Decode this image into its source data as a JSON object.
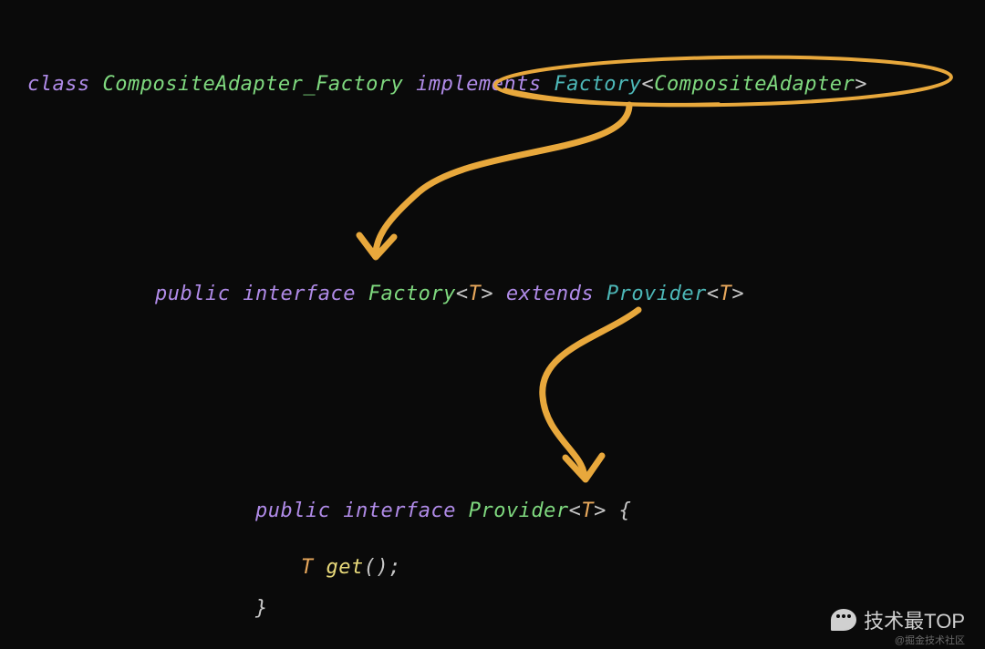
{
  "line1": {
    "class_kw": "class",
    "class_name": "CompositeAdapter_Factory",
    "implements_kw": "implements",
    "factory": "Factory",
    "lt": "<",
    "generic": "CompositeAdapter",
    "gt": ">"
  },
  "line2": {
    "public_kw": "public",
    "interface_kw": "interface",
    "factory": "Factory",
    "lt": "<",
    "t": "T",
    "gt": ">",
    "extends_kw": "extends",
    "provider": "Provider",
    "lt2": "<",
    "t2": "T",
    "gt2": ">"
  },
  "line3": {
    "public_kw": "public",
    "interface_kw": "interface",
    "provider": "Provider",
    "lt": "<",
    "t": "T",
    "gt": ">",
    "brace": "{"
  },
  "line4": {
    "rtype": "T",
    "method": "get",
    "parens": "();"
  },
  "line5": {
    "brace": "}"
  },
  "annotations": {
    "ellipse_color": "#e8a83c",
    "arrow_color": "#e8a83c"
  },
  "watermark": {
    "text": "技术最TOP",
    "sub": "@掘金技术社区"
  }
}
